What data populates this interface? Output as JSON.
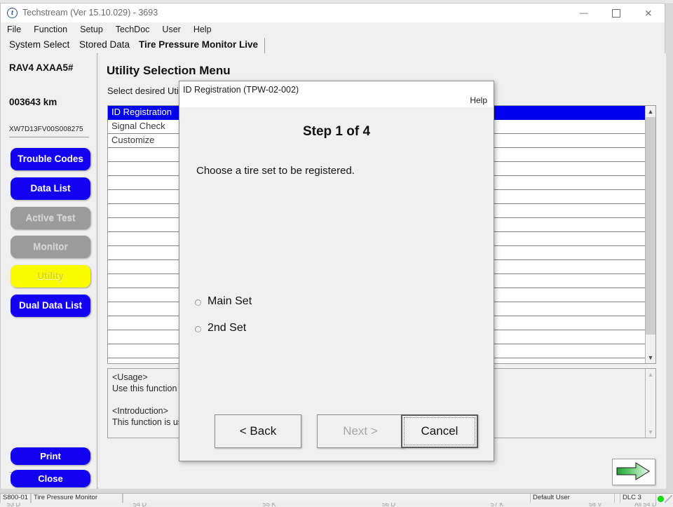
{
  "ghost": {
    "top_text": "",
    "bottom_cells": [
      "53 D",
      "54 D",
      "55 K",
      "56 D",
      "57 K",
      "58 V",
      "All  54 D"
    ]
  },
  "window": {
    "title": "Techstream (Ver 15.10.029) - 3693",
    "icon": "techstream-logo-icon",
    "minimize": "—",
    "maximize": "",
    "close": "✕"
  },
  "menubar": {
    "items": [
      "File",
      "Function",
      "Setup",
      "TechDoc",
      "User",
      "Help"
    ]
  },
  "tabs": [
    {
      "label": "System Select",
      "active": false
    },
    {
      "label": "Stored Data",
      "active": false
    },
    {
      "label": "Tire Pressure Monitor Live",
      "active": true
    }
  ],
  "sidebar": {
    "vehicle_model": "RAV4 AXAA5#",
    "odometer": "003643 km",
    "vin": "XW7D13FV00S008275",
    "buttons": [
      {
        "label": "Trouble Codes",
        "state": "enabled"
      },
      {
        "label": "Data List",
        "state": "enabled"
      },
      {
        "label": "Active Test",
        "state": "disabled"
      },
      {
        "label": "Monitor",
        "state": "disabled"
      },
      {
        "label": "Utility",
        "state": "active"
      },
      {
        "label": "Dual Data List",
        "state": "enabled"
      }
    ],
    "print_label": "Print",
    "close_label": "Close"
  },
  "main": {
    "page_title": "Utility Selection Menu",
    "page_subtitle": "Select desired Utility function then press Next.",
    "list_rows": [
      {
        "label": "ID Registration",
        "selected": true
      },
      {
        "label": "Signal Check",
        "selected": false
      },
      {
        "label": "Customize",
        "selected": false
      },
      {
        "label": "",
        "selected": false
      },
      {
        "label": "",
        "selected": false
      },
      {
        "label": "",
        "selected": false
      },
      {
        "label": "",
        "selected": false
      },
      {
        "label": "",
        "selected": false
      },
      {
        "label": "",
        "selected": false
      },
      {
        "label": "",
        "selected": false
      },
      {
        "label": "",
        "selected": false
      },
      {
        "label": "",
        "selected": false
      },
      {
        "label": "",
        "selected": false
      },
      {
        "label": "",
        "selected": false
      },
      {
        "label": "",
        "selected": false
      },
      {
        "label": "",
        "selected": false
      },
      {
        "label": "",
        "selected": false
      },
      {
        "label": "",
        "selected": false
      }
    ],
    "info_text": "<Usage>\nUse this function to register tire pressure sensor IDs.\n\n<Introduction>\nThis function is used to register the transmitter ID.",
    "next_arrow_icon": "green-right-arrow-icon"
  },
  "dialog": {
    "title": "ID Registration (TPW-02-002)",
    "help_label": "Help",
    "step_label": "Step 1 of 4",
    "prompt": "Choose a tire set to be registered.",
    "options": [
      {
        "label": "Main Set",
        "selected": false
      },
      {
        "label": "2nd Set",
        "selected": false
      }
    ],
    "back_label": "< Back",
    "next_label": "Next >",
    "cancel_label": "Cancel"
  },
  "statusbar": {
    "code": "S800-01",
    "system": "Tire Pressure Monitor",
    "blank": "",
    "user": "Default User",
    "connection": "DLC 3",
    "led_color": "#12e012"
  },
  "colors": {
    "accent_blue": "#1400f0",
    "select_blue": "#0000ee",
    "utility_yellow": "#fbfb00",
    "disabled_grey": "#9b9b9b",
    "status_green": "#12e012"
  }
}
